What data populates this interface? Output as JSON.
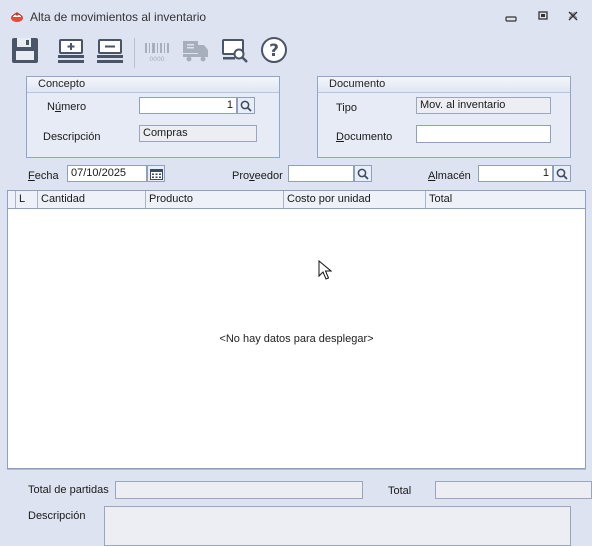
{
  "window": {
    "title": "Alta de movimientos al inventario"
  },
  "toolbar": {
    "buttons": [
      {
        "name": "save",
        "icon": "floppy-disk-icon"
      },
      {
        "name": "add-row",
        "icon": "add-row-icon"
      },
      {
        "name": "remove-row",
        "icon": "remove-row-icon"
      },
      {
        "name": "barcode",
        "icon": "barcode-icon"
      },
      {
        "name": "truck",
        "icon": "truck-icon"
      },
      {
        "name": "preview",
        "icon": "print-preview-icon"
      },
      {
        "name": "help",
        "icon": "help-icon"
      }
    ]
  },
  "concepto": {
    "title": "Concepto",
    "numero_label_pre": "N",
    "numero_label_u": "ú",
    "numero_label_post": "mero",
    "numero_value": "1",
    "descripcion_label": "Descripción",
    "descripcion_value": "Compras"
  },
  "documento": {
    "title": "Documento",
    "tipo_label": "Tipo",
    "tipo_value": "Mov. al inventario",
    "documento_label_u": "D",
    "documento_label_rest": "ocumento",
    "documento_value": ""
  },
  "filters": {
    "fecha_label_u": "F",
    "fecha_label_rest": "echa",
    "fecha_value": "07/10/2025",
    "proveedor_label_pre": "Pro",
    "proveedor_label_u": "v",
    "proveedor_label_post": "eedor",
    "proveedor_value": "",
    "almacen_label_u": "A",
    "almacen_label_rest": "lmacén",
    "almacen_value": "1"
  },
  "grid": {
    "columns": [
      "L",
      "Cantidad",
      "Producto",
      "Costo por unidad",
      "Total"
    ],
    "empty_message": "<No hay datos para desplegar>"
  },
  "footer": {
    "total_partidas_label": "Total de partidas",
    "total_partidas_value": "",
    "total_label": "Total",
    "total_value": "",
    "descripcion_label": "Descripción",
    "descripcion_value": ""
  },
  "colors": {
    "background": "#dde3f0",
    "border": "#8fa0bf",
    "accent": "#8fa6c8"
  }
}
